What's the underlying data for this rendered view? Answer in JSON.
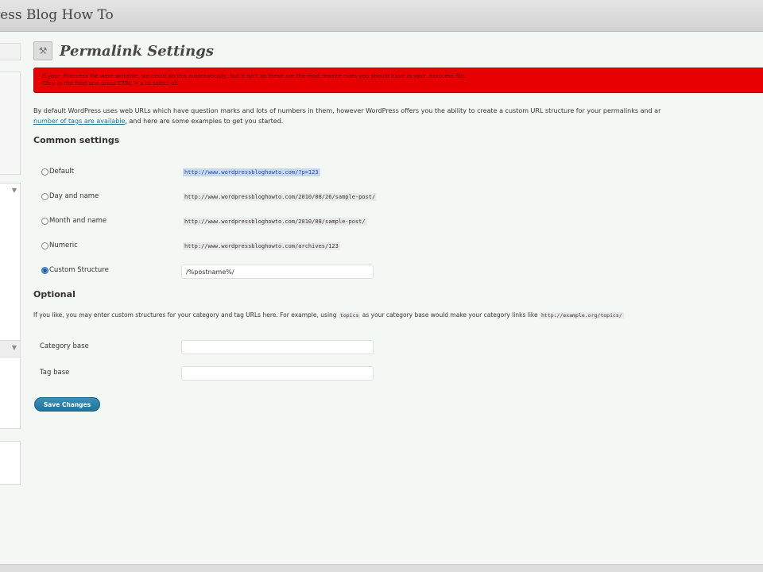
{
  "header": {
    "site_title": "ress Blog How To"
  },
  "page": {
    "title": "Permalink Settings",
    "icon": "settings-tools-icon"
  },
  "alert": {
    "line1": "If your .htaccess file were writable, we could do this automatically, but it isn't so these are the mod_rewrite rules you should have in your .htaccess file.",
    "line2": "Click in the field and press CTRL + a to select all."
  },
  "intro": {
    "text1": "By default WordPress uses web URLs which have question marks and lots of numbers in them, however WordPress offers you the ability to create a custom URL structure for your permalinks and ar",
    "link": "number of tags are available",
    "text2": ", and here are some examples to get you started."
  },
  "common": {
    "heading": "Common settings",
    "options": [
      {
        "label": "Default",
        "example": "http://www.wordpressbloghowto.com/?p=123"
      },
      {
        "label": "Day and name",
        "example": "http://www.wordpressbloghowto.com/2010/08/26/sample-post/"
      },
      {
        "label": "Month and name",
        "example": "http://www.wordpressbloghowto.com/2010/08/sample-post/"
      },
      {
        "label": "Numeric",
        "example": "http://www.wordpressbloghowto.com/archives/123"
      },
      {
        "label": "Custom Structure",
        "value": "/%postname%/"
      }
    ]
  },
  "optional": {
    "heading": "Optional",
    "text1": "If you like, you may enter custom structures for your category and tag URLs here. For example, using ",
    "code1": "topics",
    "text2": " as your category base would make your category links like ",
    "code2": "http://example.org/topics/",
    "category_label": "Category base",
    "tag_label": "Tag base",
    "category_value": "",
    "tag_value": ""
  },
  "save_label": "Save Changes",
  "colors": {
    "alert": "#e60000",
    "button": "#21759b"
  }
}
